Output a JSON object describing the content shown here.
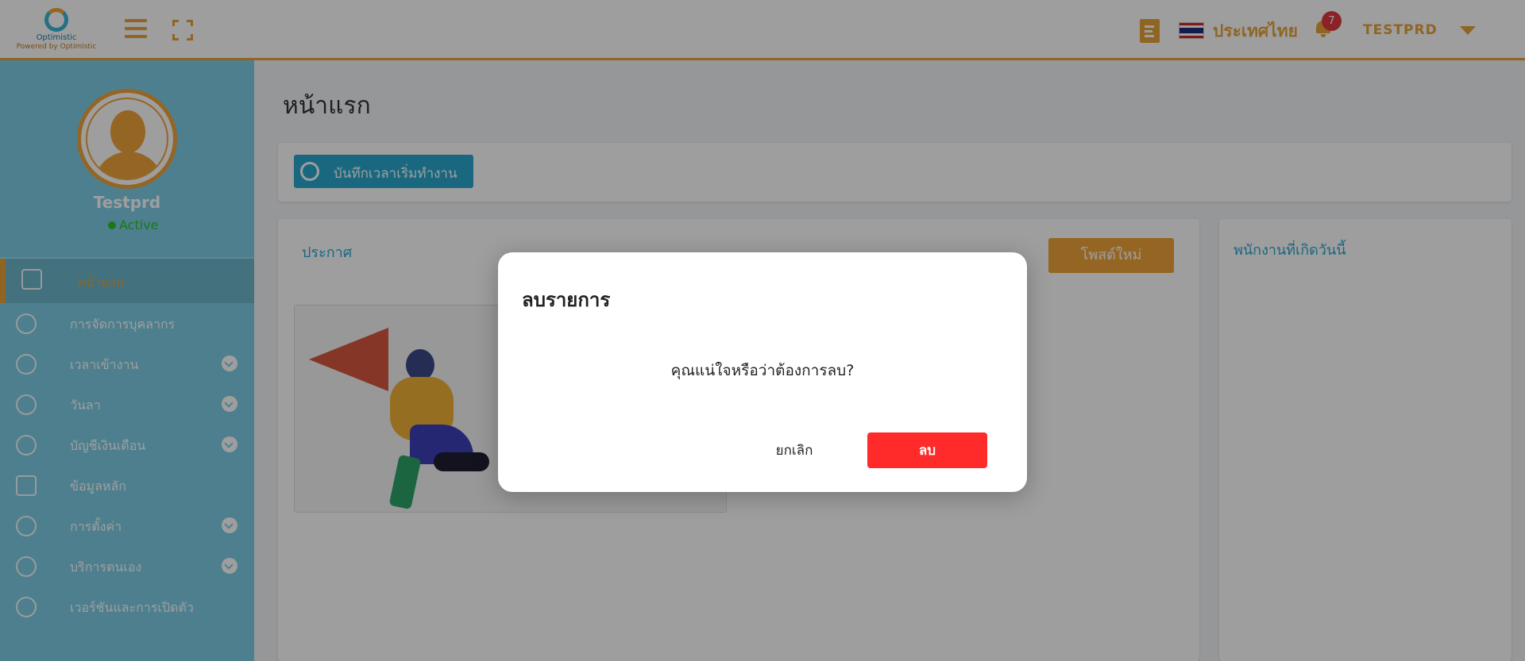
{
  "header": {
    "logo_name": "Optimistic",
    "logo_sub": "Powered by Optimistic",
    "language": "ประเทศไทย",
    "notification_count": "7",
    "user": "TESTPRD",
    "accent_color": "#e8a33a"
  },
  "sidebar": {
    "profile_name": "Testprd",
    "status": "Active",
    "items": [
      {
        "label": "หน้าแรก",
        "icon": "home-icon",
        "expandable": false,
        "active": true
      },
      {
        "label": "การจัดการบุคลากร",
        "icon": "users-gear-icon",
        "expandable": false
      },
      {
        "label": "เวลาเข้างาน",
        "icon": "clock-history-icon",
        "expandable": true
      },
      {
        "label": "วันลา",
        "icon": "clock-icon",
        "expandable": true
      },
      {
        "label": "บัญชีเงินเดือน",
        "icon": "dollar-icon",
        "expandable": true
      },
      {
        "label": "ข้อมูลหลัก",
        "icon": "calendar-box-icon",
        "expandable": false
      },
      {
        "label": "การตั้งค่า",
        "icon": "gear-icon",
        "expandable": true
      },
      {
        "label": "บริการตนเอง",
        "icon": "user-icon",
        "expandable": true
      },
      {
        "label": "เวอร์ชันและการเปิดตัว",
        "icon": "release-icon",
        "expandable": false
      }
    ]
  },
  "main": {
    "page_title": "หน้าแรก",
    "clock_in_label": "บันทึกเวลาเริ่มทำงาน",
    "announcement_title": "ประกาศ",
    "new_post_label": "โพสต์ใหม่",
    "birthday_title": "พนักงานที่เกิดวันนี้"
  },
  "modal": {
    "title": "ลบรายการ",
    "message": "คุณแน่ใจหรือว่าต้องการลบ?",
    "cancel_label": "ยกเลิก",
    "delete_label": "ลบ",
    "delete_color": "#ff2a2a"
  }
}
